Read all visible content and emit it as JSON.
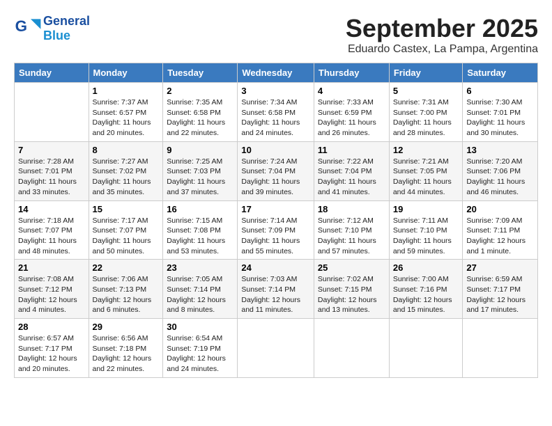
{
  "header": {
    "logo_general": "General",
    "logo_blue": "Blue",
    "month": "September 2025",
    "location": "Eduardo Castex, La Pampa, Argentina"
  },
  "days_of_week": [
    "Sunday",
    "Monday",
    "Tuesday",
    "Wednesday",
    "Thursday",
    "Friday",
    "Saturday"
  ],
  "weeks": [
    [
      {
        "day": "",
        "sunrise": "",
        "sunset": "",
        "daylight": ""
      },
      {
        "day": "1",
        "sunrise": "Sunrise: 7:37 AM",
        "sunset": "Sunset: 6:57 PM",
        "daylight": "Daylight: 11 hours and 20 minutes."
      },
      {
        "day": "2",
        "sunrise": "Sunrise: 7:35 AM",
        "sunset": "Sunset: 6:58 PM",
        "daylight": "Daylight: 11 hours and 22 minutes."
      },
      {
        "day": "3",
        "sunrise": "Sunrise: 7:34 AM",
        "sunset": "Sunset: 6:58 PM",
        "daylight": "Daylight: 11 hours and 24 minutes."
      },
      {
        "day": "4",
        "sunrise": "Sunrise: 7:33 AM",
        "sunset": "Sunset: 6:59 PM",
        "daylight": "Daylight: 11 hours and 26 minutes."
      },
      {
        "day": "5",
        "sunrise": "Sunrise: 7:31 AM",
        "sunset": "Sunset: 7:00 PM",
        "daylight": "Daylight: 11 hours and 28 minutes."
      },
      {
        "day": "6",
        "sunrise": "Sunrise: 7:30 AM",
        "sunset": "Sunset: 7:01 PM",
        "daylight": "Daylight: 11 hours and 30 minutes."
      }
    ],
    [
      {
        "day": "7",
        "sunrise": "Sunrise: 7:28 AM",
        "sunset": "Sunset: 7:01 PM",
        "daylight": "Daylight: 11 hours and 33 minutes."
      },
      {
        "day": "8",
        "sunrise": "Sunrise: 7:27 AM",
        "sunset": "Sunset: 7:02 PM",
        "daylight": "Daylight: 11 hours and 35 minutes."
      },
      {
        "day": "9",
        "sunrise": "Sunrise: 7:25 AM",
        "sunset": "Sunset: 7:03 PM",
        "daylight": "Daylight: 11 hours and 37 minutes."
      },
      {
        "day": "10",
        "sunrise": "Sunrise: 7:24 AM",
        "sunset": "Sunset: 7:04 PM",
        "daylight": "Daylight: 11 hours and 39 minutes."
      },
      {
        "day": "11",
        "sunrise": "Sunrise: 7:22 AM",
        "sunset": "Sunset: 7:04 PM",
        "daylight": "Daylight: 11 hours and 41 minutes."
      },
      {
        "day": "12",
        "sunrise": "Sunrise: 7:21 AM",
        "sunset": "Sunset: 7:05 PM",
        "daylight": "Daylight: 11 hours and 44 minutes."
      },
      {
        "day": "13",
        "sunrise": "Sunrise: 7:20 AM",
        "sunset": "Sunset: 7:06 PM",
        "daylight": "Daylight: 11 hours and 46 minutes."
      }
    ],
    [
      {
        "day": "14",
        "sunrise": "Sunrise: 7:18 AM",
        "sunset": "Sunset: 7:07 PM",
        "daylight": "Daylight: 11 hours and 48 minutes."
      },
      {
        "day": "15",
        "sunrise": "Sunrise: 7:17 AM",
        "sunset": "Sunset: 7:07 PM",
        "daylight": "Daylight: 11 hours and 50 minutes."
      },
      {
        "day": "16",
        "sunrise": "Sunrise: 7:15 AM",
        "sunset": "Sunset: 7:08 PM",
        "daylight": "Daylight: 11 hours and 53 minutes."
      },
      {
        "day": "17",
        "sunrise": "Sunrise: 7:14 AM",
        "sunset": "Sunset: 7:09 PM",
        "daylight": "Daylight: 11 hours and 55 minutes."
      },
      {
        "day": "18",
        "sunrise": "Sunrise: 7:12 AM",
        "sunset": "Sunset: 7:10 PM",
        "daylight": "Daylight: 11 hours and 57 minutes."
      },
      {
        "day": "19",
        "sunrise": "Sunrise: 7:11 AM",
        "sunset": "Sunset: 7:10 PM",
        "daylight": "Daylight: 11 hours and 59 minutes."
      },
      {
        "day": "20",
        "sunrise": "Sunrise: 7:09 AM",
        "sunset": "Sunset: 7:11 PM",
        "daylight": "Daylight: 12 hours and 1 minute."
      }
    ],
    [
      {
        "day": "21",
        "sunrise": "Sunrise: 7:08 AM",
        "sunset": "Sunset: 7:12 PM",
        "daylight": "Daylight: 12 hours and 4 minutes."
      },
      {
        "day": "22",
        "sunrise": "Sunrise: 7:06 AM",
        "sunset": "Sunset: 7:13 PM",
        "daylight": "Daylight: 12 hours and 6 minutes."
      },
      {
        "day": "23",
        "sunrise": "Sunrise: 7:05 AM",
        "sunset": "Sunset: 7:14 PM",
        "daylight": "Daylight: 12 hours and 8 minutes."
      },
      {
        "day": "24",
        "sunrise": "Sunrise: 7:03 AM",
        "sunset": "Sunset: 7:14 PM",
        "daylight": "Daylight: 12 hours and 11 minutes."
      },
      {
        "day": "25",
        "sunrise": "Sunrise: 7:02 AM",
        "sunset": "Sunset: 7:15 PM",
        "daylight": "Daylight: 12 hours and 13 minutes."
      },
      {
        "day": "26",
        "sunrise": "Sunrise: 7:00 AM",
        "sunset": "Sunset: 7:16 PM",
        "daylight": "Daylight: 12 hours and 15 minutes."
      },
      {
        "day": "27",
        "sunrise": "Sunrise: 6:59 AM",
        "sunset": "Sunset: 7:17 PM",
        "daylight": "Daylight: 12 hours and 17 minutes."
      }
    ],
    [
      {
        "day": "28",
        "sunrise": "Sunrise: 6:57 AM",
        "sunset": "Sunset: 7:17 PM",
        "daylight": "Daylight: 12 hours and 20 minutes."
      },
      {
        "day": "29",
        "sunrise": "Sunrise: 6:56 AM",
        "sunset": "Sunset: 7:18 PM",
        "daylight": "Daylight: 12 hours and 22 minutes."
      },
      {
        "day": "30",
        "sunrise": "Sunrise: 6:54 AM",
        "sunset": "Sunset: 7:19 PM",
        "daylight": "Daylight: 12 hours and 24 minutes."
      },
      {
        "day": "",
        "sunrise": "",
        "sunset": "",
        "daylight": ""
      },
      {
        "day": "",
        "sunrise": "",
        "sunset": "",
        "daylight": ""
      },
      {
        "day": "",
        "sunrise": "",
        "sunset": "",
        "daylight": ""
      },
      {
        "day": "",
        "sunrise": "",
        "sunset": "",
        "daylight": ""
      }
    ]
  ]
}
